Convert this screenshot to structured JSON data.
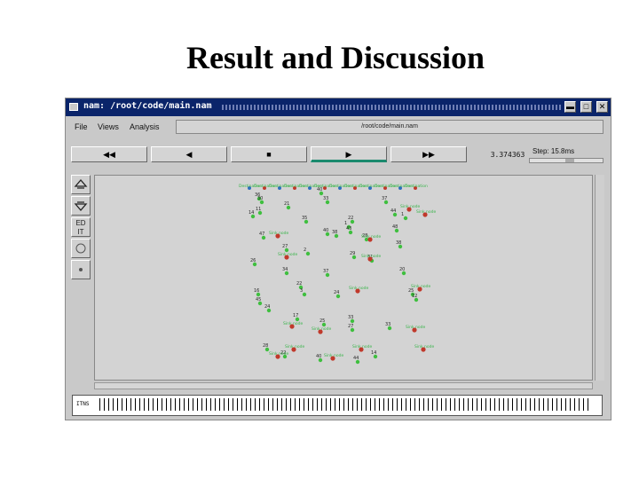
{
  "slide": {
    "title": "Result and Discussion"
  },
  "window": {
    "title": "nam: /root/code/main.nam",
    "buttons": {
      "minimize": "▬",
      "maximize": "□",
      "close": "✕"
    }
  },
  "menubar": {
    "items": [
      "File",
      "Views",
      "Analysis"
    ],
    "path": "/root/code/main.nam"
  },
  "controls": {
    "rewind": "◀◀",
    "back": "◀",
    "stop": "■",
    "play": "▶",
    "forward": "▶▶",
    "time": "3.374363",
    "step_label": "Step:",
    "step_value": "15.8ms"
  },
  "tools": {
    "edit": "ED IT"
  },
  "timeline": {
    "label": "ITNS"
  },
  "colors": {
    "node_green": "#3fbf3f",
    "node_red": "#c0392b",
    "label_green": "#39b54a",
    "titlebar": "#0a246a",
    "canvas_bg": "#d3d3d3"
  },
  "nodes": {
    "top_row_label": "Destination",
    "labels": [
      "40",
      "36",
      "30",
      "21",
      "33",
      "11",
      "14",
      "35",
      "22",
      "1",
      "43",
      "40",
      "38",
      "28",
      "47",
      "48",
      "1",
      "44",
      "37",
      "38",
      "27",
      "2",
      "29",
      "31",
      "26",
      "34",
      "37",
      "22",
      "3",
      "24",
      "16",
      "20",
      "25",
      "12",
      "24",
      "45",
      "17",
      "25",
      "33",
      "27",
      "33",
      "28",
      "22",
      "40",
      "14",
      "44"
    ],
    "sink_label": "Sink node"
  }
}
